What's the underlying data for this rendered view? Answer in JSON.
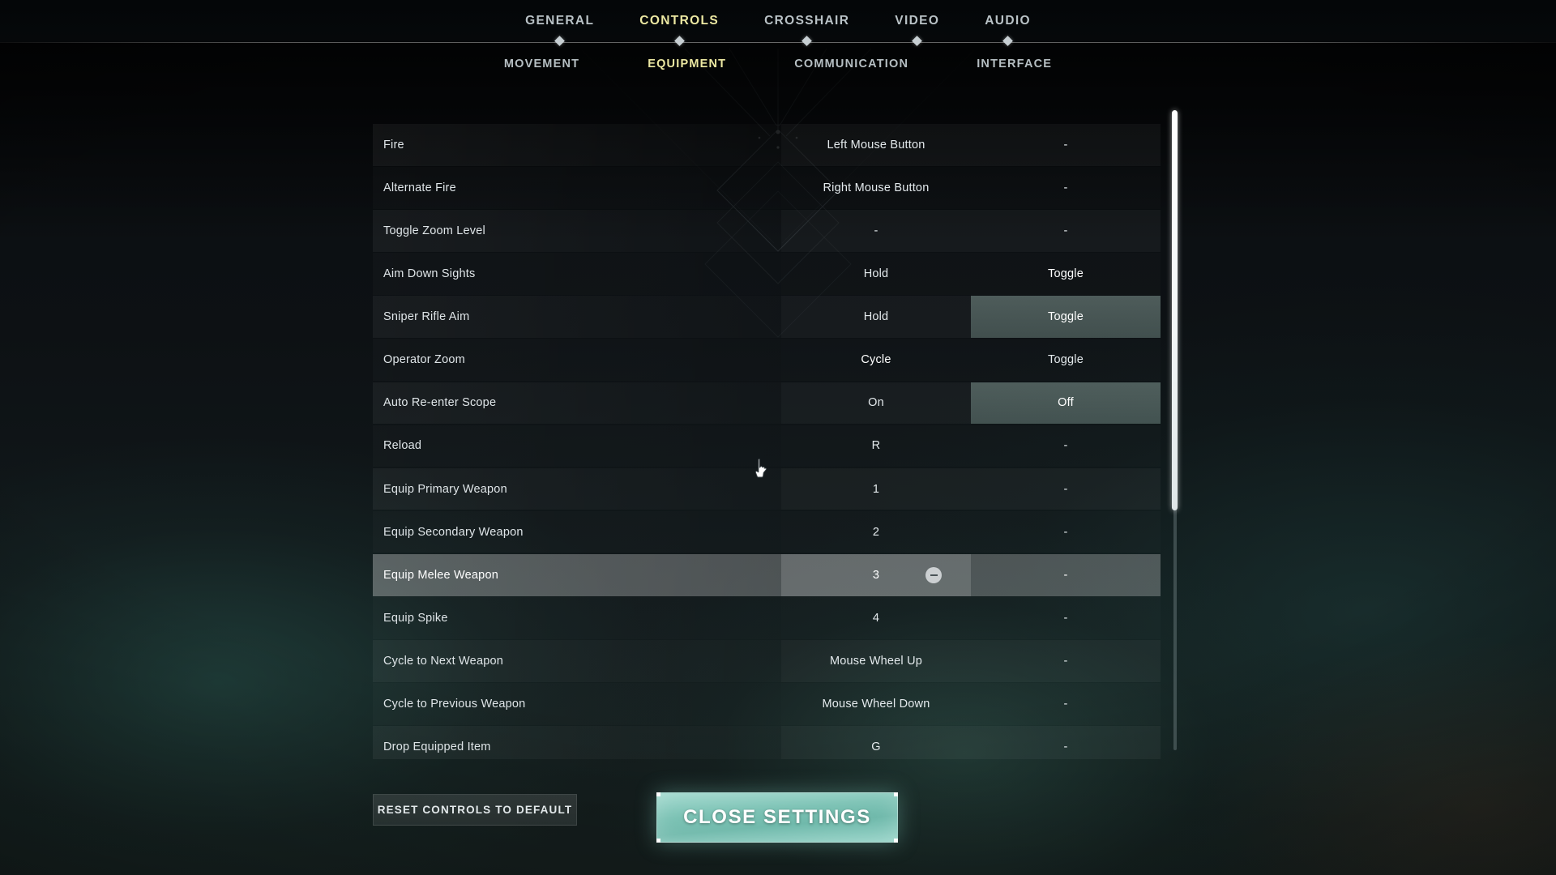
{
  "nav": {
    "primary_tabs": [
      {
        "label": "GENERAL",
        "active": false
      },
      {
        "label": "CONTROLS",
        "active": true
      },
      {
        "label": "CROSSHAIR",
        "active": false
      },
      {
        "label": "VIDEO",
        "active": false
      },
      {
        "label": "AUDIO",
        "active": false
      }
    ],
    "secondary_tabs": [
      {
        "label": "MOVEMENT",
        "active": false
      },
      {
        "label": "EQUIPMENT",
        "active": true
      },
      {
        "label": "COMMUNICATION",
        "active": false
      },
      {
        "label": "INTERFACE",
        "active": false
      }
    ]
  },
  "table": {
    "rows": [
      {
        "name": "Fire",
        "bind1": "Left Mouse Button",
        "bind2": "-"
      },
      {
        "name": "Alternate Fire",
        "bind1": "Right Mouse Button",
        "bind2": "-"
      },
      {
        "name": "Toggle Zoom Level",
        "bind1": "-",
        "bind2": "-"
      },
      {
        "name": "Aim Down Sights",
        "bind1": "Hold",
        "bind2": "Toggle"
      },
      {
        "name": "Sniper Rifle Aim",
        "bind1": "Hold",
        "bind2": "Toggle"
      },
      {
        "name": "Operator Zoom",
        "bind1": "Cycle",
        "bind2": "Toggle"
      },
      {
        "name": "Auto Re-enter Scope",
        "bind1": "On",
        "bind2": "Off"
      },
      {
        "name": "Reload",
        "bind1": "R",
        "bind2": "-"
      },
      {
        "name": "Equip Primary Weapon",
        "bind1": "1",
        "bind2": "-"
      },
      {
        "name": "Equip Secondary Weapon",
        "bind1": "2",
        "bind2": "-"
      },
      {
        "name": "Equip Melee Weapon",
        "bind1": "3",
        "bind2": "-"
      },
      {
        "name": "Equip Spike",
        "bind1": "4",
        "bind2": "-"
      },
      {
        "name": "Cycle to Next Weapon",
        "bind1": "Mouse Wheel Up",
        "bind2": "-"
      },
      {
        "name": "Cycle to Previous Weapon",
        "bind1": "Mouse Wheel Down",
        "bind2": "-"
      },
      {
        "name": "Drop Equipped Item",
        "bind1": "G",
        "bind2": "-"
      }
    ],
    "hovered_row_index": 10,
    "selected_cells": [
      {
        "row": 3,
        "col": 2,
        "style": "sel-green"
      },
      {
        "row": 4,
        "col": 2,
        "style": "sel-green"
      },
      {
        "row": 5,
        "col": 1,
        "style": "sel"
      },
      {
        "row": 5,
        "col": 2,
        "style": "tint-green"
      },
      {
        "row": 6,
        "col": 2,
        "style": "sel-green"
      }
    ],
    "remove_button_icon": "minus-circle-icon"
  },
  "footer": {
    "reset_label": "RESET CONTROLS TO DEFAULT",
    "close_label": "CLOSE SETTINGS"
  },
  "colors": {
    "accent_yellow": "#ece8a2",
    "accent_teal": "#7bc2b4",
    "row_text": "#dfe5e8"
  },
  "scrollbar": {
    "thumb_top_pct": 0,
    "thumb_height_pct": 62.5
  }
}
